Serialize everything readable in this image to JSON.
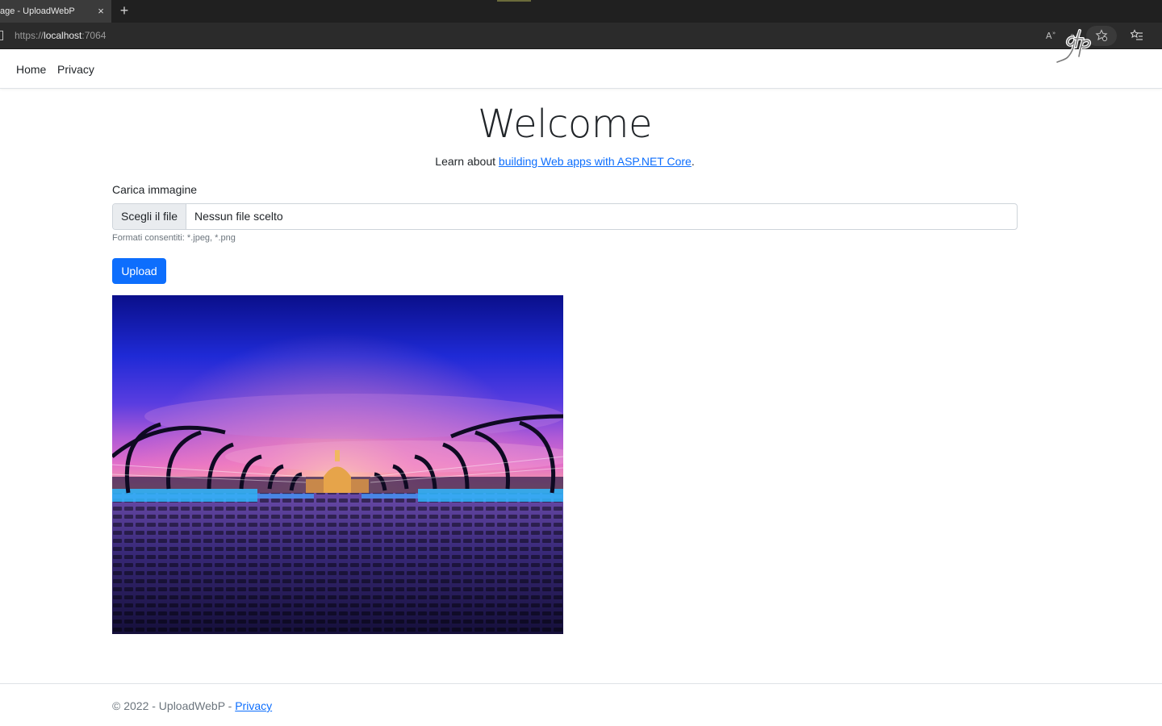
{
  "browser": {
    "tab_title": "age - UploadWebP",
    "tab_close": "×",
    "new_tab": "+",
    "url_scheme": "https://",
    "url_host": "localhost",
    "url_port": ":7064"
  },
  "nav": {
    "items": [
      {
        "label": "Home"
      },
      {
        "label": "Privacy"
      }
    ]
  },
  "main": {
    "title": "Welcome",
    "learn_prefix": "Learn about ",
    "learn_link": "building Web apps with ASP.NET Core",
    "learn_suffix": ".",
    "upload_label": "Carica immagine",
    "file_button": "Scegli il file",
    "file_status": "Nessun file scelto",
    "hint": "Formati consentiti: *.jpeg, *.png",
    "upload_button": "Upload"
  },
  "footer": {
    "text": "© 2022 - UploadWebP - ",
    "link": "Privacy"
  },
  "colors": {
    "primary": "#0d6efd",
    "muted": "#6c757d"
  }
}
